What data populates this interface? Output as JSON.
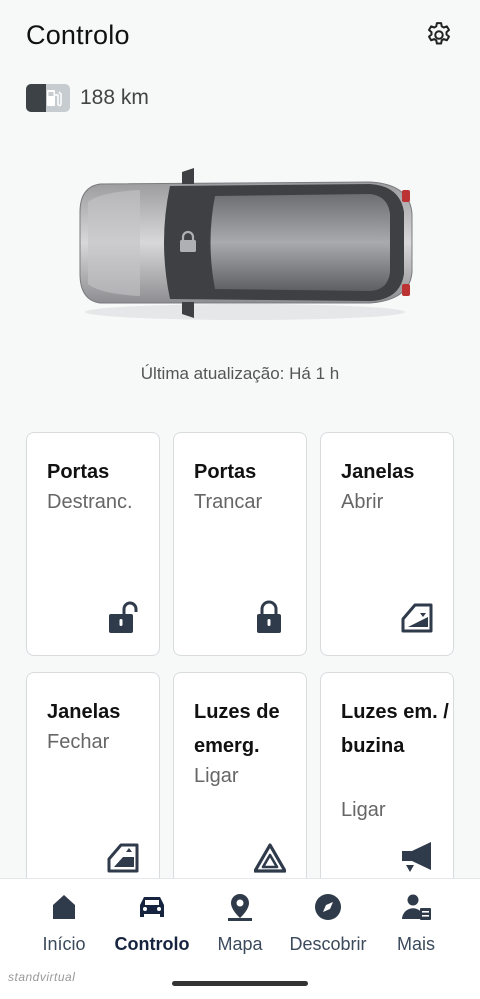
{
  "header": {
    "title": "Controlo",
    "settings_icon": "gear-icon"
  },
  "fuel": {
    "range": "188 km",
    "level": 0.45,
    "icon": "fuel-pump-icon"
  },
  "vehicle": {
    "lock_state": "locked",
    "last_update": "Última atualização: Há 1 h"
  },
  "cards": [
    {
      "title": "Portas",
      "action": "Destranc.",
      "icon": "unlock-icon"
    },
    {
      "title": "Portas",
      "action": "Trancar",
      "icon": "lock-icon"
    },
    {
      "title": "Janelas",
      "action": "Abrir",
      "icon": "window-open-icon"
    },
    {
      "title": "Janelas",
      "action": "Fechar",
      "icon": "window-close-icon"
    },
    {
      "title": "Luzes de emerg.",
      "action": "Ligar",
      "icon": "hazard-icon"
    },
    {
      "title": "Luzes em. / buzina",
      "action": "Ligar",
      "icon": "horn-icon"
    }
  ],
  "nav": {
    "active": "Controlo",
    "items": [
      {
        "label": "Início",
        "icon": "home-icon"
      },
      {
        "label": "Controlo",
        "icon": "car-icon"
      },
      {
        "label": "Mapa",
        "icon": "map-pin-icon"
      },
      {
        "label": "Descobrir",
        "icon": "compass-icon"
      },
      {
        "label": "Mais",
        "icon": "person-more-icon"
      }
    ]
  },
  "watermark": "standvirtual",
  "colors": {
    "accent": "#16243f",
    "icon_dark": "#2f3a4a",
    "card_border": "#d9dcdf"
  }
}
